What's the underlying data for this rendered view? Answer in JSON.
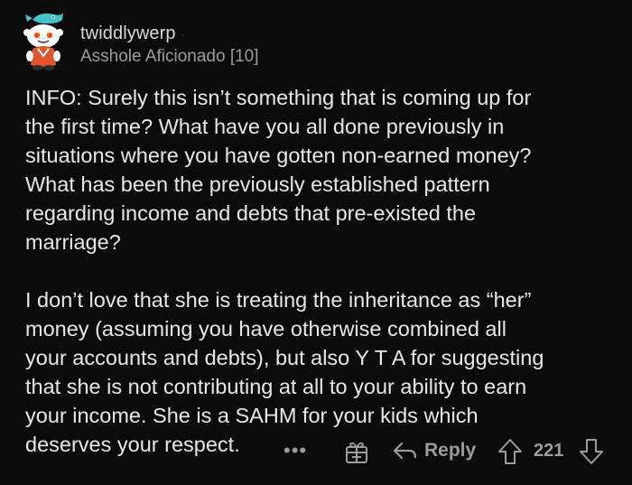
{
  "comment": {
    "author": "twiddlywerp",
    "separator": "·",
    "flair": "Asshole Aficionado [10]",
    "paragraphs": [
      "INFO: Surely this isn’t something that is coming up for\nthe first time? What have you all done previously in\nsituations where you have gotten non-earned money?\nWhat has been the previously established pattern\nregarding income and debts that pre-existed the\nmarriage?",
      "I don’t love that she is treating the inheritance as “her”\nmoney (assuming you have otherwise combined all\nyour accounts and debts), but also Y T A for suggesting\nthat she is not contributing at all to your ability to earn\nyour income. She is a SAHM for your kids which\ndeserves your respect."
    ]
  },
  "actions": {
    "more_label": "•••",
    "reply_label": "Reply",
    "score": "221"
  },
  "icons": {
    "avatar": "snoo-avatar",
    "more": "more-dots-icon",
    "award": "gift-award-icon",
    "reply": "reply-arrow-icon",
    "upvote": "upvote-arrow-icon",
    "downvote": "downvote-arrow-icon"
  },
  "colors": {
    "background": "#0b0b0b",
    "text": "#e6e8ea",
    "muted": "#9a9c9e"
  }
}
